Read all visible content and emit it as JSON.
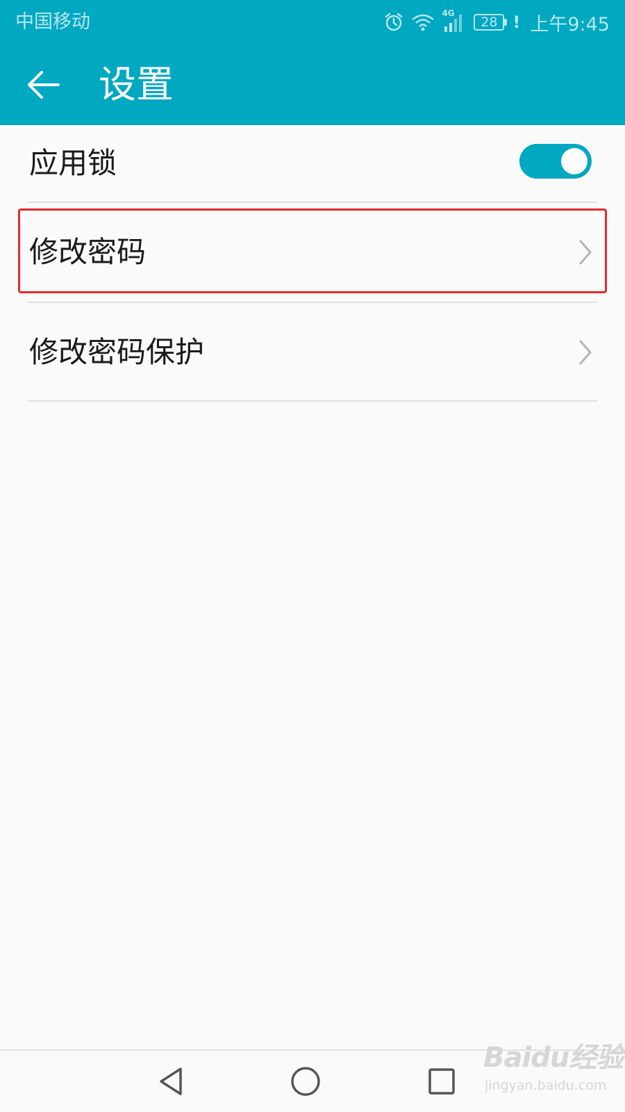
{
  "status_bar": {
    "carrier": "中国移动",
    "network_badge": "4G",
    "battery": "28",
    "warning": "!",
    "time": "上午9:45",
    "icons": [
      "alarm-icon",
      "wifi-icon",
      "signal-icon",
      "battery-icon"
    ]
  },
  "title_bar": {
    "back_icon": "arrow-left-icon",
    "title": "设置"
  },
  "settings": {
    "items": [
      {
        "label": "应用锁",
        "control": "toggle",
        "enabled": true
      },
      {
        "label": "修改密码",
        "control": "chevron-right-icon",
        "highlighted": true
      },
      {
        "label": "修改密码保护",
        "control": "chevron-right-icon"
      }
    ]
  },
  "nav_bar": {
    "icons": [
      "back-triangle-icon",
      "home-circle-icon",
      "recents-square-icon"
    ]
  },
  "watermark": {
    "logo": "Baidu经验",
    "url": "jingyan.baidu.com"
  },
  "colors": {
    "accent": "#00a8c2",
    "highlight_border": "#e52b2b",
    "background": "#fafafa",
    "divider": "#e0e0e0"
  }
}
